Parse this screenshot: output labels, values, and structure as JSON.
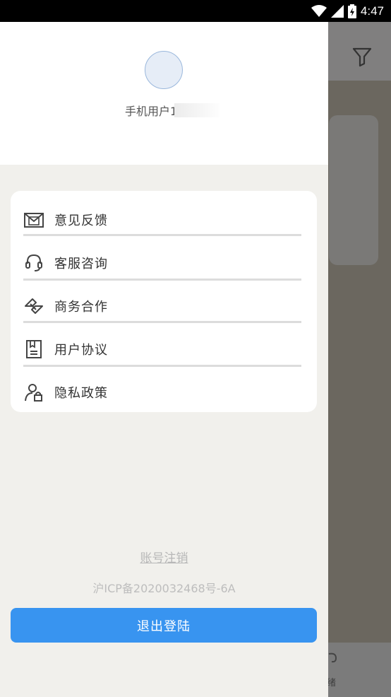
{
  "status_bar": {
    "time": "4:47"
  },
  "profile": {
    "username": "手机用户1"
  },
  "menu": [
    {
      "label": "意见反馈",
      "icon": "mail-icon"
    },
    {
      "label": "客服咨询",
      "icon": "headset-icon"
    },
    {
      "label": "商务合作",
      "icon": "handshake-icon"
    },
    {
      "label": "用户协议",
      "icon": "document-icon"
    },
    {
      "label": "隐私政策",
      "icon": "user-lock-icon"
    }
  ],
  "footer": {
    "cancel_account": "账号注销",
    "icp": "沪ICP备2020032468号-6A",
    "logout": "退出登陆"
  },
  "background": {
    "bottom_tab_label": "绪"
  },
  "colors": {
    "accent": "#3894f0",
    "drawer_bg": "#f1f0ec",
    "scrim": "#6b675f"
  }
}
